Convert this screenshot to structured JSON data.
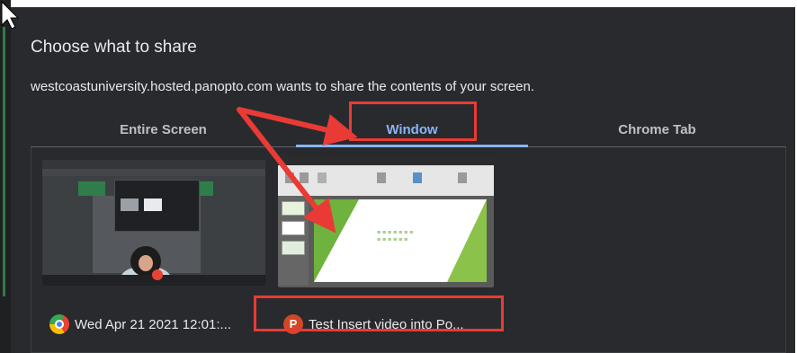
{
  "dialog": {
    "title": "Choose what to share",
    "description": "westcoastuniversity.hosted.panopto.com wants to share the contents of your screen."
  },
  "tabs": [
    {
      "label": "Entire Screen",
      "selected": false
    },
    {
      "label": "Window",
      "selected": true
    },
    {
      "label": "Chrome Tab",
      "selected": false
    }
  ],
  "windows": [
    {
      "label": "Wed Apr 21 2021 12:01:...",
      "icon": "chrome-icon"
    },
    {
      "label": "Test Insert video into Po...",
      "icon": "powerpoint-icon",
      "icon_letter": "P"
    }
  ],
  "colors": {
    "dialog_bg": "#292a2d",
    "accent": "#8ab4f8",
    "annotation": "#ea3a35"
  }
}
